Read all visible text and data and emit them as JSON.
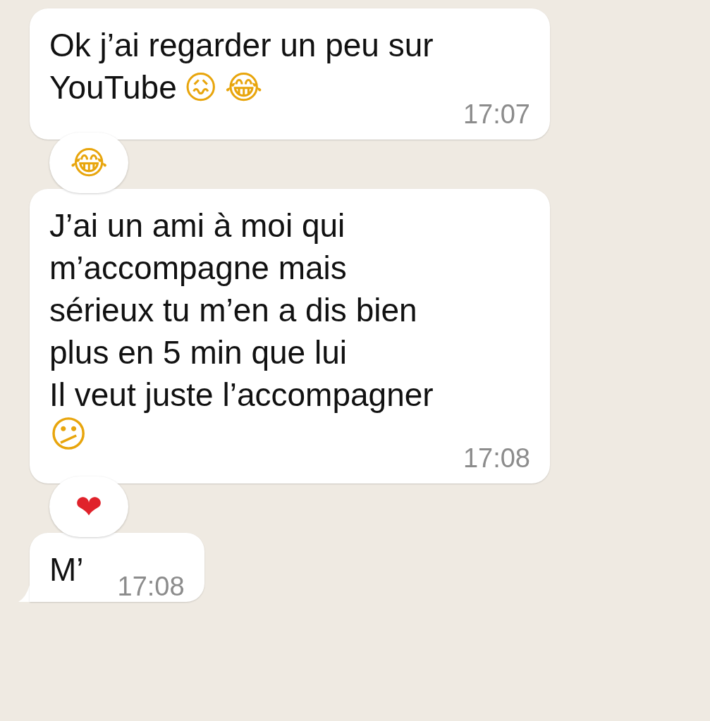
{
  "messages": [
    {
      "lines": [
        {
          "text": "Ok j’ai regarder un peu sur"
        },
        {
          "text": "YouTube",
          "emojis": [
            "😖",
            "😂"
          ]
        }
      ],
      "time": "17:07",
      "tail": false,
      "reaction": "😂"
    },
    {
      "lines": [
        {
          "text": "J’ai un ami à moi qui"
        },
        {
          "text": "m’accompagne mais"
        },
        {
          "text": "sérieux tu m’en a dis bien"
        },
        {
          "text": "plus en 5 min que lui"
        },
        {
          "text": "Il veut juste l’accompagner"
        },
        {
          "emojis": [
            "😕"
          ]
        }
      ],
      "time": "17:08",
      "tail": false,
      "reaction": "❤"
    },
    {
      "lines": [
        {
          "text": "M’"
        }
      ],
      "time": "17:08",
      "tail": true
    }
  ]
}
